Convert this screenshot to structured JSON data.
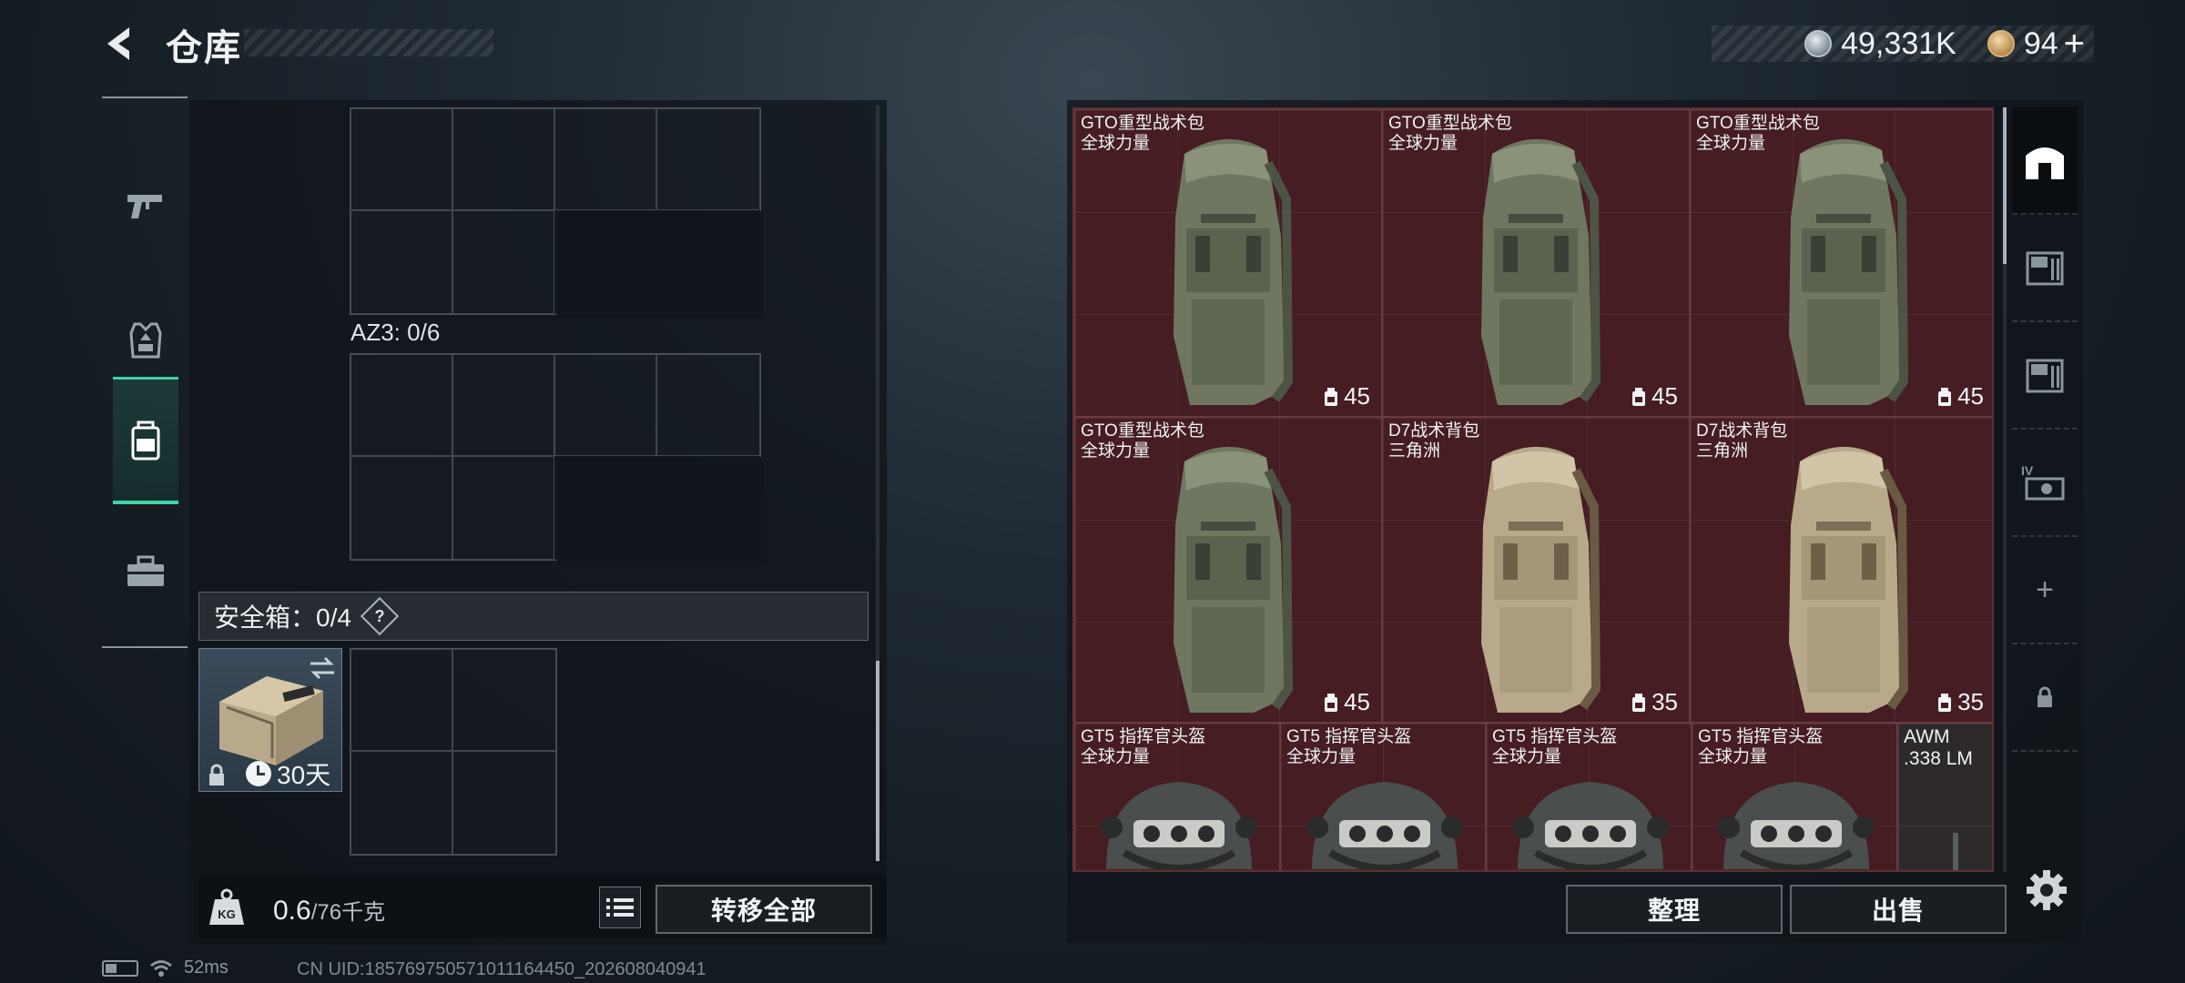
{
  "header": {
    "title": "仓库",
    "currency_silver": "49,331K",
    "currency_gold": "94",
    "plus": "+"
  },
  "left_rail": {
    "tabs": [
      {
        "icon": "pistol-icon",
        "active": false
      },
      {
        "icon": "armor-vest-icon",
        "active": false
      },
      {
        "icon": "backpack-icon",
        "active": true
      },
      {
        "icon": "toolbox-icon",
        "active": false
      }
    ]
  },
  "container": {
    "az3_label": "AZ3: 0/6",
    "safe_box_label": "安全箱：0/4",
    "safe_box_help": "?",
    "safe_box_timer": "30天",
    "weight_value": "0.6",
    "weight_max": "/76千克",
    "transfer_all": "转移全部"
  },
  "storage": {
    "items": [
      {
        "name": "GTO重型战术包",
        "origin": "全球力量",
        "capacity": "45",
        "kind": "green-pack"
      },
      {
        "name": "GTO重型战术包",
        "origin": "全球力量",
        "capacity": "45",
        "kind": "green-pack"
      },
      {
        "name": "GTO重型战术包",
        "origin": "全球力量",
        "capacity": "45",
        "kind": "green-pack"
      },
      {
        "name": "GTO重型战术包",
        "origin": "全球力量",
        "capacity": "45",
        "kind": "green-pack"
      },
      {
        "name": "D7战术背包",
        "origin": "三角洲",
        "capacity": "35",
        "kind": "tan-pack"
      },
      {
        "name": "D7战术背包",
        "origin": "三角洲",
        "capacity": "35",
        "kind": "tan-pack"
      }
    ],
    "helmets": [
      {
        "name": "GT5 指挥官头盔",
        "origin": "全球力量"
      },
      {
        "name": "GT5 指挥官头盔",
        "origin": "全球力量"
      },
      {
        "name": "GT5 指挥官头盔",
        "origin": "全球力量"
      },
      {
        "name": "GT5 指挥官头盔",
        "origin": "全球力量"
      }
    ],
    "ammo": {
      "name": "AWM",
      "origin": ".338 LM"
    },
    "sort_button": "整理",
    "sell_button": "出售"
  },
  "side_tabs": {
    "items": [
      "warehouse-icon",
      "storage-crate-icon",
      "storage-crate-icon",
      "storage-iv-icon",
      "add-icon",
      "lock-icon"
    ],
    "add_label": "+"
  },
  "status_bar": {
    "ping": "52ms",
    "uid": "CN UID:185769750571011164450_202608040941"
  }
}
